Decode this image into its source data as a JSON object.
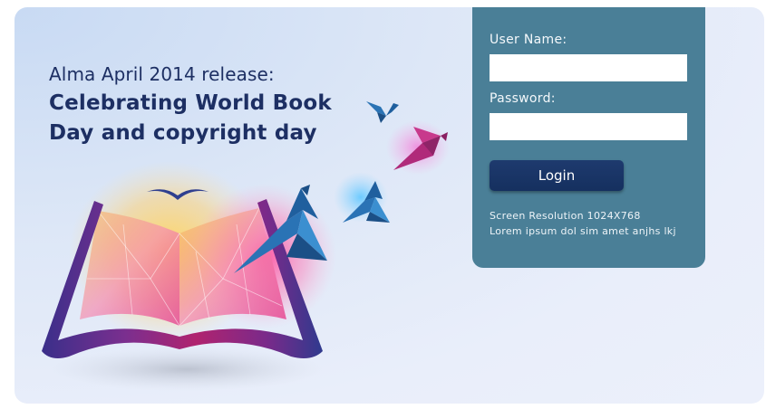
{
  "hero": {
    "release_line": "Alma April 2014 release:",
    "headline_line1": "Celebrating World Book",
    "headline_line2": "Day and copyright day"
  },
  "login": {
    "username_label": "User Name:",
    "username_value": "",
    "password_label": "Password:",
    "password_value": "",
    "button_label": "Login",
    "info_line1": "Screen Resolution 1024X768",
    "info_line2": "Lorem ipsum dol sim amet anjhs lkj"
  },
  "colors": {
    "panel": "#4a7f97",
    "button": "#1b3464",
    "headline": "#1d2f63"
  },
  "icons": [
    "open-book-illustration",
    "origami-bird-icon",
    "seagull-icon"
  ]
}
